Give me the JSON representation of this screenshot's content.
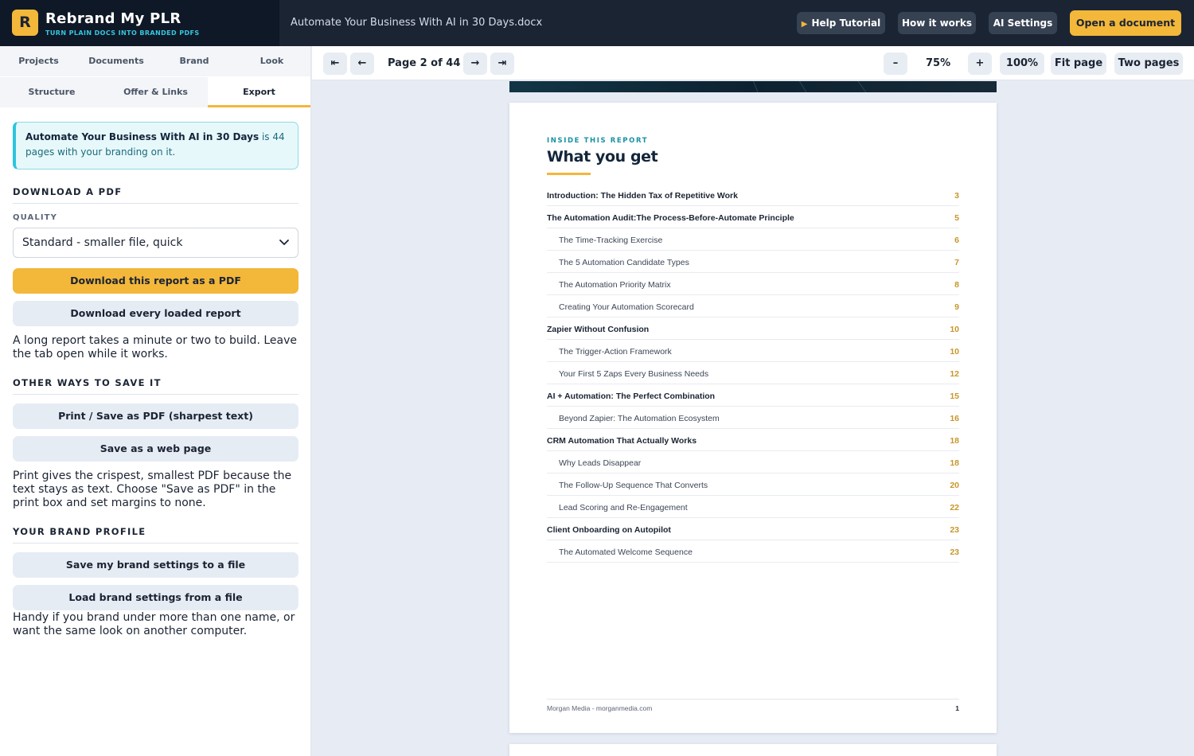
{
  "header": {
    "logo_letter": "R",
    "app_name": "Rebrand My PLR",
    "tagline": "TURN PLAIN DOCS INTO BRANDED PDFS",
    "doc_name": "Automate Your Business With AI in 30 Days.docx",
    "help_label": "Help Tutorial",
    "how_label": "How it works",
    "ai_label": "AI Settings",
    "open_label": "Open a document"
  },
  "tabs": {
    "projects": "Projects",
    "documents": "Documents",
    "brand": "Brand",
    "look": "Look",
    "structure": "Structure",
    "offer": "Offer & Links",
    "export": "Export"
  },
  "info": {
    "title": "Automate Your Business With AI in 30 Days",
    "rest": " is 44 pages with your branding on it."
  },
  "download": {
    "section": "DOWNLOAD A PDF",
    "quality_label": "QUALITY",
    "quality_value": "Standard - smaller file, quick",
    "primary_btn": "Download this report as a PDF",
    "all_btn": "Download every loaded report",
    "note": "A long report takes a minute or two to build. Leave the tab open while it works."
  },
  "other": {
    "section": "OTHER WAYS TO SAVE IT",
    "print_btn": "Print / Save as PDF (sharpest text)",
    "web_btn": "Save as a web page",
    "note": "Print gives the crispest, smallest PDF because the text stays as text. Choose \"Save as PDF\" in the print box and set margins to none."
  },
  "profile": {
    "section": "YOUR BRAND PROFILE",
    "save_btn": "Save my brand settings to a file",
    "load_btn": "Load brand settings from a file",
    "note": "Handy if you brand under more than one name, or want the same look on another computer."
  },
  "toolbar": {
    "first": "⇤",
    "prev": "←",
    "page_label": "Page 2 of 44",
    "next": "→",
    "last": "⇥",
    "zoom_out": "–",
    "zoom": "75%",
    "zoom_in": "+",
    "hundred": "100%",
    "fit": "Fit page",
    "two": "Two pages"
  },
  "page": {
    "eyebrow": "INSIDE THIS REPORT",
    "heading": "What you get",
    "toc": [
      {
        "title": "Introduction: The Hidden Tax of Repetitive Work",
        "page": "3",
        "level": "main"
      },
      {
        "title": "The Automation Audit:The Process-Before-Automate Principle",
        "page": "5",
        "level": "main"
      },
      {
        "title": "The Time-Tracking Exercise",
        "page": "6",
        "level": "sub"
      },
      {
        "title": "The 5 Automation Candidate Types",
        "page": "7",
        "level": "sub"
      },
      {
        "title": "The Automation Priority Matrix",
        "page": "8",
        "level": "sub"
      },
      {
        "title": "Creating Your Automation Scorecard",
        "page": "9",
        "level": "sub"
      },
      {
        "title": "Zapier Without Confusion",
        "page": "10",
        "level": "main"
      },
      {
        "title": "The Trigger-Action Framework",
        "page": "10",
        "level": "sub"
      },
      {
        "title": "Your First 5 Zaps Every Business Needs",
        "page": "12",
        "level": "sub"
      },
      {
        "title": "AI + Automation: The Perfect Combination",
        "page": "15",
        "level": "main"
      },
      {
        "title": "Beyond Zapier: The Automation Ecosystem",
        "page": "16",
        "level": "sub"
      },
      {
        "title": "CRM Automation That Actually Works",
        "page": "18",
        "level": "main"
      },
      {
        "title": "Why Leads Disappear",
        "page": "18",
        "level": "sub"
      },
      {
        "title": "The Follow-Up Sequence That Converts",
        "page": "20",
        "level": "sub"
      },
      {
        "title": "Lead Scoring and Re-Engagement",
        "page": "22",
        "level": "sub"
      },
      {
        "title": "Client Onboarding on Autopilot",
        "page": "23",
        "level": "main"
      },
      {
        "title": "The Automated Welcome Sequence",
        "page": "23",
        "level": "sub"
      }
    ],
    "footer_text": "Morgan Media - morganmedia.com",
    "footer_page": "1"
  },
  "colors": {
    "accent": "#f3b73a",
    "header_bg": "#1b2433",
    "teal": "#2cc5dc"
  }
}
